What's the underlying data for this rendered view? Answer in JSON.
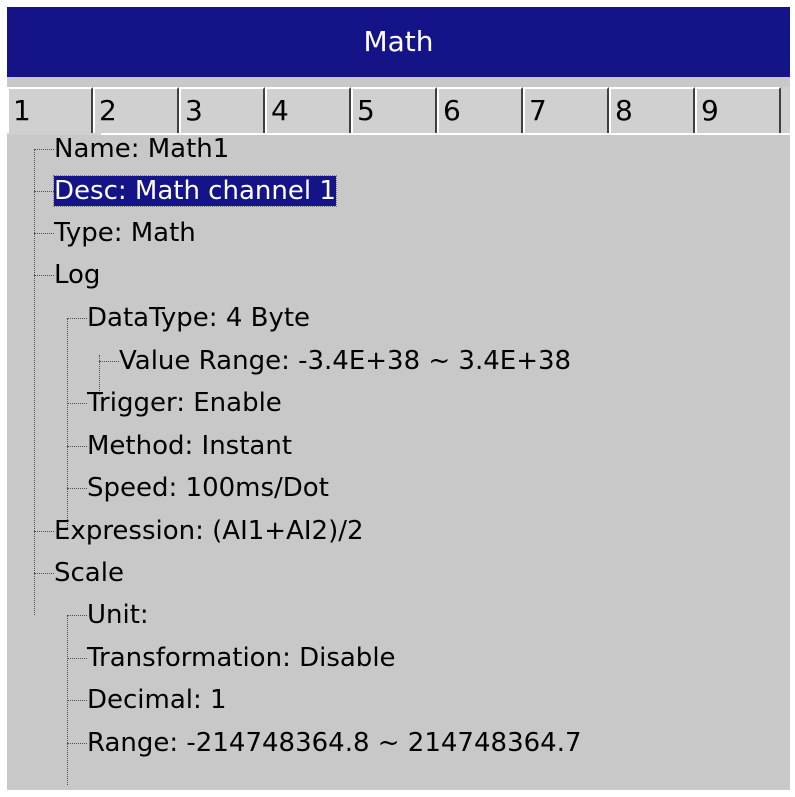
{
  "window": {
    "title": "Math"
  },
  "tabs": [
    "1",
    "2",
    "3",
    "4",
    "5",
    "6",
    "7",
    "8",
    "9"
  ],
  "tree": {
    "name": "Name: Math1",
    "desc": "Desc: Math channel 1",
    "type": "Type: Math",
    "log": {
      "label": "Log",
      "datatype": "DataType: 4 Byte",
      "value_range": "Value Range: -3.4E+38  ~ 3.4E+38",
      "trigger": "Trigger: Enable",
      "method": "Method: Instant",
      "speed": "Speed: 100ms/Dot"
    },
    "expression": "Expression: (AI1+AI2)/2",
    "scale": {
      "label": "Scale",
      "unit": "Unit:",
      "transformation": "Transformation: Disable",
      "decimal": "Decimal: 1",
      "range": "Range: -214748364.8 ~ 214748364.7"
    }
  },
  "colors": {
    "titlebar": "#141488",
    "panel": "#c8c8c8",
    "selection": "#141488"
  }
}
